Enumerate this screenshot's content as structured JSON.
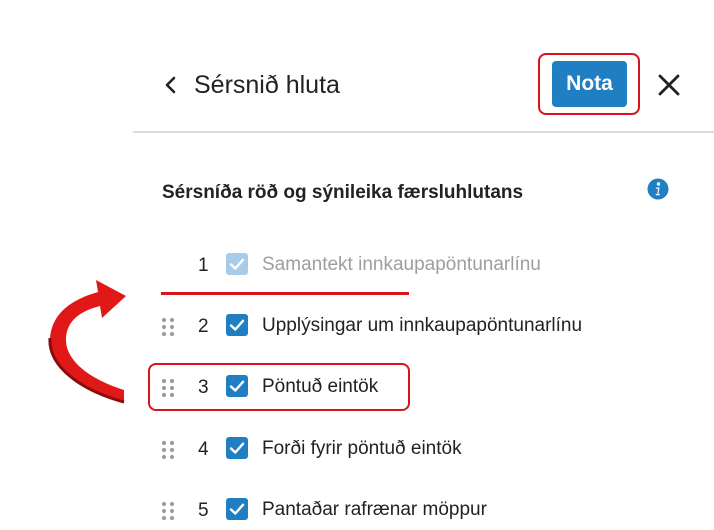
{
  "header": {
    "title": "Sérsnið hluta",
    "apply_label": "Nota"
  },
  "section": {
    "heading": "Sérsníða röð og sýnileika færsluhlutans"
  },
  "items": [
    {
      "number": "1",
      "label": "Samantekt innkaupapöntunarlínu",
      "checked": true,
      "disabled": true
    },
    {
      "number": "2",
      "label": "Upplýsingar um innkaupapöntunarlínu",
      "checked": true,
      "disabled": false
    },
    {
      "number": "3",
      "label": "Pöntuð eintök",
      "checked": true,
      "disabled": false
    },
    {
      "number": "4",
      "label": "Forði fyrir pöntuð eintök",
      "checked": true,
      "disabled": false
    },
    {
      "number": "5",
      "label": "Pantaðar rafrænar möppur",
      "checked": true,
      "disabled": false
    }
  ],
  "colors": {
    "accent": "#1f7fc2",
    "highlight": "#d7141a"
  }
}
